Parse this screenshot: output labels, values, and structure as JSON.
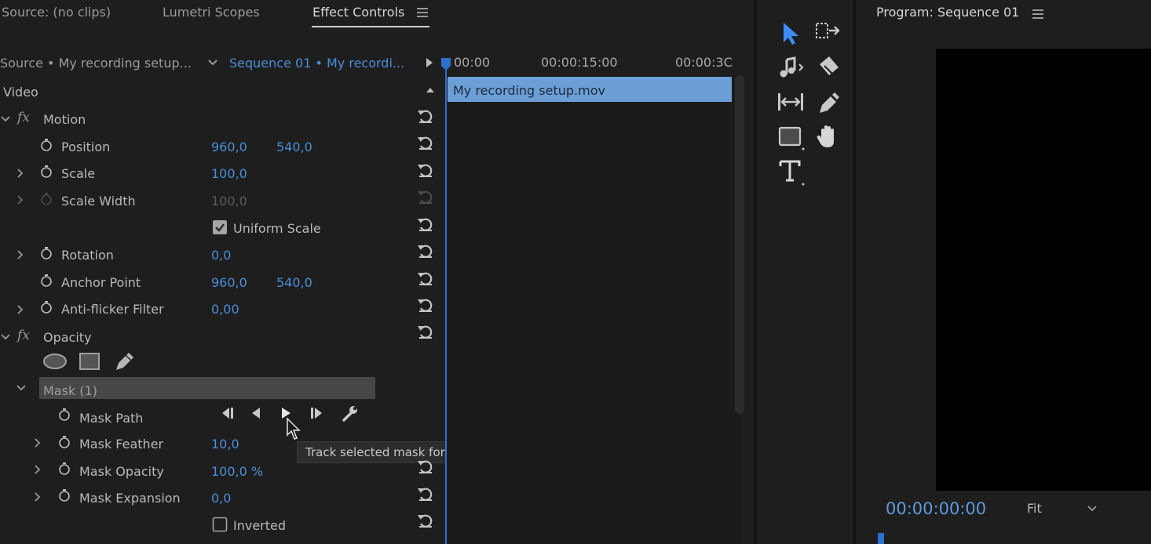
{
  "tabs": [
    {
      "label": "Source: (no clips)",
      "active": false
    },
    {
      "label": "Lumetri Scopes",
      "active": false
    },
    {
      "label": "Effect Controls",
      "active": true
    }
  ],
  "program_title": "Program: Sequence 01",
  "source_selector": "Source • My recording setup...",
  "sequence_selector": "Sequence 01 • My recordi...",
  "timeline": {
    "ticks": [
      "00:00",
      "00:00:15:00",
      "00:00:3C"
    ],
    "clip_name": "My recording setup.mov"
  },
  "section_video": "Video",
  "motion": {
    "label": "Motion",
    "position": {
      "label": "Position",
      "x": "960,0",
      "y": "540,0"
    },
    "scale": {
      "label": "Scale",
      "value": "100,0"
    },
    "scale_width": {
      "label": "Scale Width",
      "value": "100,0"
    },
    "uniform_scale": {
      "label": "Uniform Scale",
      "checked": true
    },
    "rotation": {
      "label": "Rotation",
      "value": "0,0"
    },
    "anchor_point": {
      "label": "Anchor Point",
      "x": "960,0",
      "y": "540,0"
    },
    "anti_flicker": {
      "label": "Anti-flicker Filter",
      "value": "0,00"
    }
  },
  "opacity": {
    "label": "Opacity",
    "mask": {
      "label": "Mask (1)",
      "path_label": "Mask Path",
      "feather": {
        "label": "Mask Feather",
        "value": "10,0"
      },
      "opacity": {
        "label": "Mask Opacity",
        "value": "100,0 %"
      },
      "expansion": {
        "label": "Mask Expansion",
        "value": "0,0"
      },
      "inverted": {
        "label": "Inverted",
        "checked": false
      }
    }
  },
  "tooltip": "Track selected mask forward",
  "program": {
    "timecode": "00:00:00:00",
    "zoom": "Fit"
  },
  "colors": {
    "accent": "#4a8fd8",
    "clip": "#6c9fd6",
    "playhead": "#2f6fce"
  },
  "icons": [
    "menu-icon",
    "stopwatch-icon",
    "reset-icon",
    "fx-icon",
    "ellipse-mask-icon",
    "rectangle-mask-icon",
    "pen-mask-icon",
    "track-backward-one-icon",
    "track-backward-icon",
    "track-forward-icon",
    "track-forward-one-icon",
    "wrench-icon",
    "selection-tool-icon",
    "track-select-icon",
    "ripple-edit-icon",
    "razor-icon",
    "slip-icon",
    "pen-icon",
    "rectangle-tool-icon",
    "hand-icon",
    "type-icon"
  ]
}
